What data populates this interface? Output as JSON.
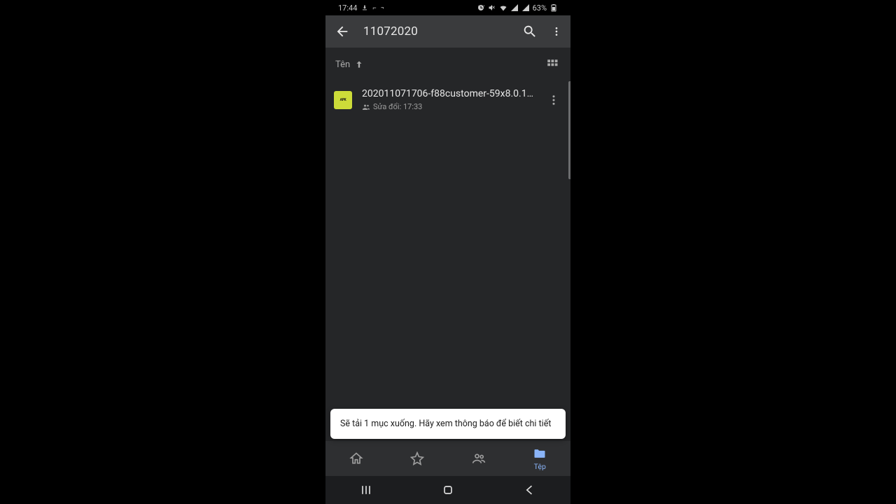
{
  "status": {
    "time": "17:44",
    "battery": "63%"
  },
  "appbar": {
    "title": "11072020"
  },
  "sort": {
    "label": "Tên"
  },
  "file": {
    "icon_label": "APK",
    "name": "202011071706-f88customer-59x8.0.1-r…",
    "meta": "Sửa đổi: 17:33"
  },
  "toast": {
    "text": "Sẽ tải 1 mục xuống. Hãy xem thông báo để biết chi tiết"
  },
  "tabs": {
    "files_label": "Tệp"
  }
}
